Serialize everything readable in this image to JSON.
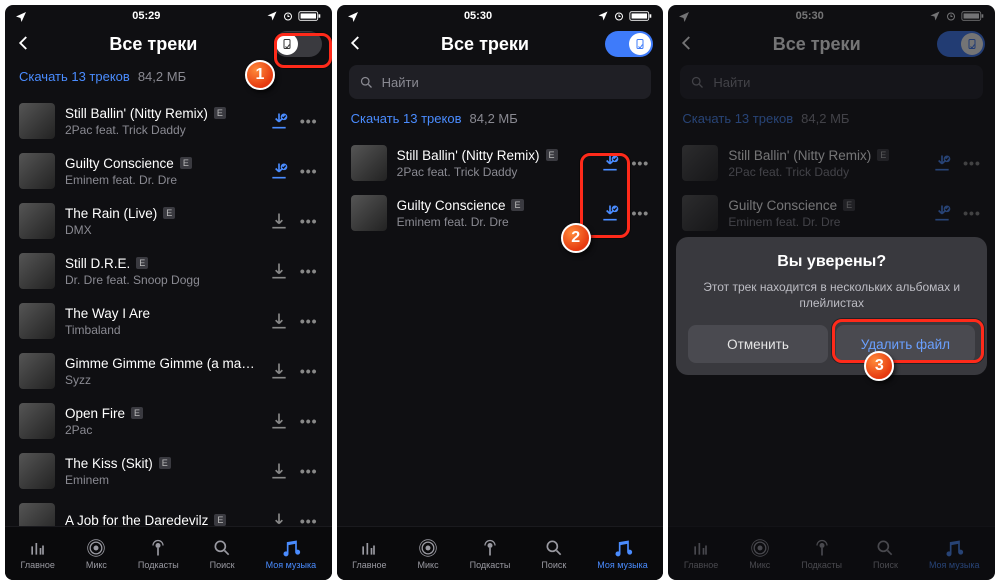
{
  "status": {
    "time1": "05:29",
    "time2": "05:30",
    "time3": "05:30"
  },
  "header": {
    "title": "Все треки"
  },
  "summary": {
    "link": "Скачать 13 треков",
    "size": "84,2 МБ"
  },
  "search": {
    "placeholder": "Найти"
  },
  "tracks_full": [
    {
      "name": "Still Ballin' (Nitty Remix)",
      "artist": "2Pac feat. Trick Daddy",
      "explicit": true,
      "dl": "blue"
    },
    {
      "name": "Guilty Conscience",
      "artist": "Eminem feat. Dr. Dre",
      "explicit": true,
      "dl": "blue"
    },
    {
      "name": "The Rain (Live)",
      "artist": "DMX",
      "explicit": true,
      "dl": "gray"
    },
    {
      "name": "Still D.R.E.",
      "artist": "Dr. Dre feat. Snoop Dogg",
      "explicit": true,
      "dl": "gray"
    },
    {
      "name": "The Way I Are",
      "artist": "Timbaland",
      "explicit": false,
      "dl": "gray"
    },
    {
      "name": "Gimme Gimme Gimme (a man…",
      "artist": "Syzz",
      "explicit": false,
      "dl": "gray"
    },
    {
      "name": "Open Fire",
      "artist": "2Pac",
      "explicit": true,
      "dl": "gray"
    },
    {
      "name": "The Kiss (Skit)",
      "artist": "Eminem",
      "explicit": true,
      "dl": "gray"
    },
    {
      "name": "A Job for the Daredevilz",
      "artist": "",
      "explicit": true,
      "dl": "gray"
    }
  ],
  "tracks_downloaded": [
    {
      "name": "Still Ballin' (Nitty Remix)",
      "artist": "2Pac feat. Trick Daddy",
      "explicit": true
    },
    {
      "name": "Guilty Conscience",
      "artist": "Eminem feat. Dr. Dre",
      "explicit": true
    }
  ],
  "tracks_dim": [
    {
      "name": "Still Ballin' (Nitty Remix)",
      "artist": "2Pac feat. Trick Daddy",
      "explicit": true
    },
    {
      "name": "Guilty Conscience",
      "artist": "Eminem feat. Dr. Dre",
      "explicit": true
    }
  ],
  "tabs": {
    "home": "Главное",
    "mix": "Микс",
    "podcasts": "Подкасты",
    "search": "Поиск",
    "music": "Моя музыка"
  },
  "dialog": {
    "title": "Вы уверены?",
    "body": "Этот трек находится в нескольких альбомах и плейлистах",
    "cancel": "Отменить",
    "confirm": "Удалить файл"
  },
  "badges": {
    "b1": "1",
    "b2": "2",
    "b3": "3"
  }
}
